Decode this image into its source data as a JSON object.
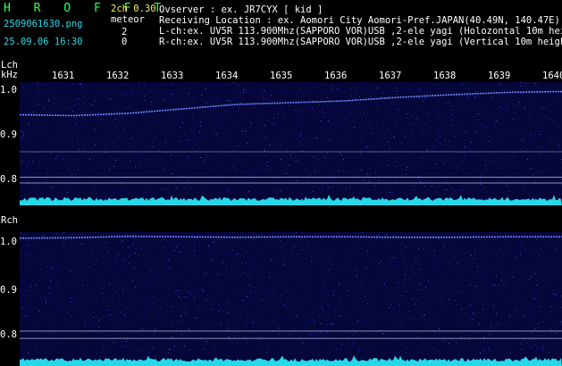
{
  "header": {
    "logo": "H R O F F T",
    "version": "2ch 0.30",
    "filename": "2509061630.png",
    "datetime": "25.09.06 16:30",
    "meteor_label": "meteor",
    "meteor_l": "2",
    "meteor_r": "0",
    "observer": "Ovserver              : ex. JR7CYX [ kid ]",
    "location": "Receiving Location : ex. Aomori City Aomori-Pref.JAPAN(40.49N, 140.47E)",
    "lch_info": "L-ch:ex. UV5R 113.900Mhz(SAPPORO VOR)USB ,2-ele yagi (Holozontal 10m height)",
    "rch_info": "R-ch:ex. UV5R 113.900Mhz(SAPPORO VOR)USB ,2-ele yagi (Vertical 10m height)"
  },
  "time_axis": {
    "labels": [
      "1631",
      "1632",
      "1633",
      "1634",
      "1635",
      "1636",
      "1637",
      "1638",
      "1639",
      "1640"
    ]
  },
  "lch": {
    "label": "Lch",
    "unit": "kHz",
    "yticks": [
      "1.0",
      "0.9",
      "0.8"
    ],
    "carrier_khz": [
      0.945,
      0.943,
      0.948,
      0.958,
      0.968,
      0.972,
      0.976,
      0.984,
      0.99,
      0.995,
      0.997
    ],
    "reference_khz": [
      0.862,
      0.805,
      0.792
    ]
  },
  "rch": {
    "label": "Rch",
    "unit": "",
    "yticks": [
      "1.0",
      "0.9",
      "0.8"
    ],
    "carrier_khz": [
      1.008,
      1.009,
      1.012,
      1.011,
      1.01,
      1.011,
      1.011,
      1.01,
      1.01,
      1.011,
      1.011
    ],
    "reference_khz": [
      0.808,
      0.792
    ]
  },
  "colors": {
    "background": "#000000",
    "waterfall": "#05063a",
    "carrier": "#6a8cff",
    "noise_floor": "#27d8e8",
    "logo": "#30ff50",
    "version": "#f2f25a",
    "info_text": "#27d8e8"
  }
}
